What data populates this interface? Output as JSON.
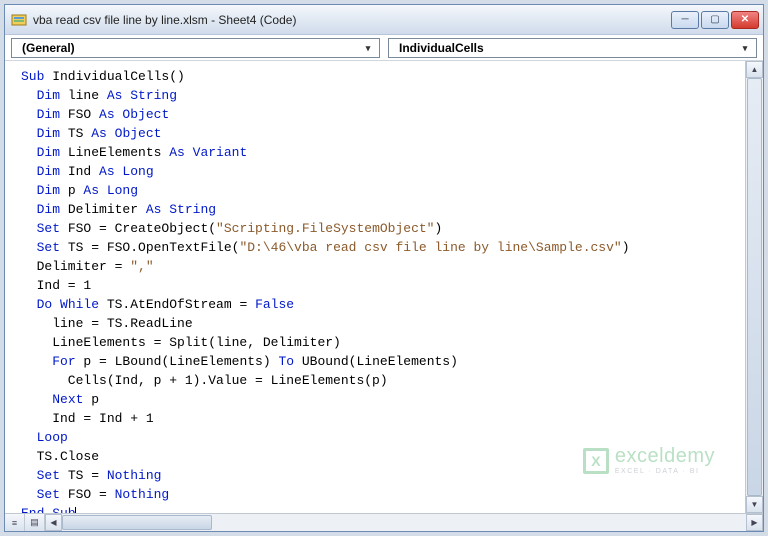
{
  "window": {
    "title": "vba read csv file line by line.xlsm - Sheet4 (Code)"
  },
  "dropdowns": {
    "left": "(General)",
    "right": "IndividualCells"
  },
  "code": {
    "lines": [
      {
        "indent": 0,
        "segs": [
          [
            "kw",
            "Sub"
          ],
          [
            "",
            " IndividualCells()"
          ]
        ]
      },
      {
        "indent": 1,
        "segs": [
          [
            "kw",
            "Dim"
          ],
          [
            "",
            " line "
          ],
          [
            "kw",
            "As String"
          ]
        ]
      },
      {
        "indent": 1,
        "segs": [
          [
            "kw",
            "Dim"
          ],
          [
            "",
            " FSO "
          ],
          [
            "kw",
            "As Object"
          ]
        ]
      },
      {
        "indent": 1,
        "segs": [
          [
            "kw",
            "Dim"
          ],
          [
            "",
            " TS "
          ],
          [
            "kw",
            "As Object"
          ]
        ]
      },
      {
        "indent": 1,
        "segs": [
          [
            "kw",
            "Dim"
          ],
          [
            "",
            " LineElements "
          ],
          [
            "kw",
            "As Variant"
          ]
        ]
      },
      {
        "indent": 1,
        "segs": [
          [
            "kw",
            "Dim"
          ],
          [
            "",
            " Ind "
          ],
          [
            "kw",
            "As Long"
          ]
        ]
      },
      {
        "indent": 1,
        "segs": [
          [
            "kw",
            "Dim"
          ],
          [
            "",
            " p "
          ],
          [
            "kw",
            "As Long"
          ]
        ]
      },
      {
        "indent": 1,
        "segs": [
          [
            "kw",
            "Dim"
          ],
          [
            "",
            " Delimiter "
          ],
          [
            "kw",
            "As String"
          ]
        ]
      },
      {
        "indent": 1,
        "segs": [
          [
            "kw",
            "Set"
          ],
          [
            "",
            " FSO = CreateObject("
          ],
          [
            "str",
            "\"Scripting.FileSystemObject\""
          ],
          [
            "",
            ")"
          ]
        ]
      },
      {
        "indent": 1,
        "segs": [
          [
            "kw",
            "Set"
          ],
          [
            "",
            " TS = FSO.OpenTextFile("
          ],
          [
            "str",
            "\"D:\\46\\vba read csv file line by line\\Sample.csv\""
          ],
          [
            "",
            ")"
          ]
        ]
      },
      {
        "indent": 1,
        "segs": [
          [
            "",
            "Delimiter = "
          ],
          [
            "str",
            "\",\""
          ]
        ]
      },
      {
        "indent": 1,
        "segs": [
          [
            "",
            "Ind = 1"
          ]
        ]
      },
      {
        "indent": 1,
        "segs": [
          [
            "kw",
            "Do While"
          ],
          [
            "",
            " TS.AtEndOfStream = "
          ],
          [
            "kw",
            "False"
          ]
        ]
      },
      {
        "indent": 2,
        "segs": [
          [
            "",
            "line = TS.ReadLine"
          ]
        ]
      },
      {
        "indent": 2,
        "segs": [
          [
            "",
            "LineElements = Split(line, Delimiter)"
          ]
        ]
      },
      {
        "indent": 2,
        "segs": [
          [
            "kw",
            "For"
          ],
          [
            "",
            " p = LBound(LineElements) "
          ],
          [
            "kw",
            "To"
          ],
          [
            "",
            " UBound(LineElements)"
          ]
        ]
      },
      {
        "indent": 3,
        "segs": [
          [
            "",
            "Cells(Ind, p + 1).Value = LineElements(p)"
          ]
        ]
      },
      {
        "indent": 2,
        "segs": [
          [
            "kw",
            "Next"
          ],
          [
            "",
            " p"
          ]
        ]
      },
      {
        "indent": 2,
        "segs": [
          [
            "",
            "Ind = Ind + 1"
          ]
        ]
      },
      {
        "indent": 1,
        "segs": [
          [
            "kw",
            "Loop"
          ]
        ]
      },
      {
        "indent": 1,
        "segs": [
          [
            "",
            "TS.Close"
          ]
        ]
      },
      {
        "indent": 1,
        "segs": [
          [
            "kw",
            "Set"
          ],
          [
            "",
            " TS = "
          ],
          [
            "kw",
            "Nothing"
          ]
        ]
      },
      {
        "indent": 1,
        "segs": [
          [
            "kw",
            "Set"
          ],
          [
            "",
            " FSO = "
          ],
          [
            "kw",
            "Nothing"
          ]
        ]
      },
      {
        "indent": 0,
        "segs": [
          [
            "kw",
            "End Sub"
          ]
        ],
        "cursor": true
      }
    ]
  },
  "watermark": {
    "brand": "exceldemy",
    "tagline": "EXCEL · DATA · BI",
    "iconletter": "X"
  }
}
